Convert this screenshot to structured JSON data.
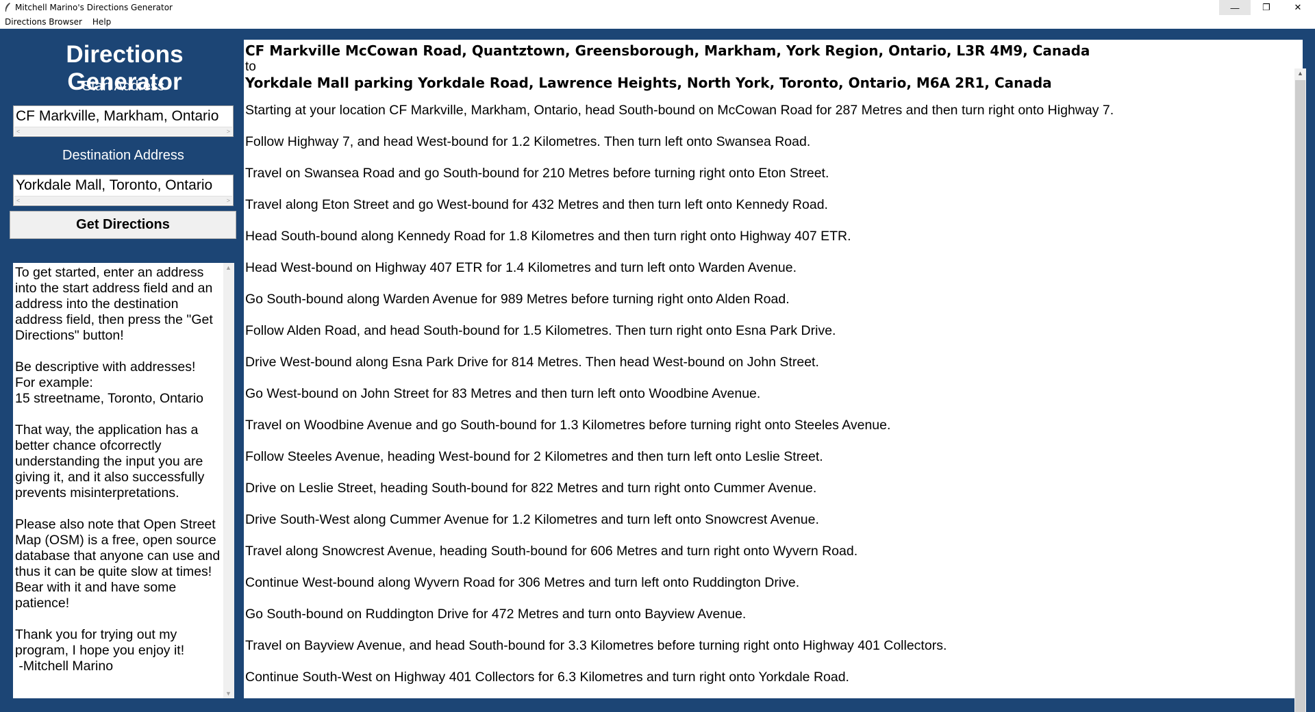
{
  "window": {
    "title": "Mitchell Marino's Directions Generator",
    "minimize_glyph": "—",
    "maximize_glyph": "❐",
    "close_glyph": "✕"
  },
  "menu": {
    "items": [
      "Directions Browser",
      "Help"
    ]
  },
  "sidebar": {
    "heading": "Directions Generator",
    "start_label": "Start Address",
    "start_value": "CF Markville, Markham, Ontario",
    "destination_label": "Destination Address",
    "destination_value": "Yorkdale Mall, Toronto, Ontario",
    "button_label": "Get Directions",
    "info_text": "To get started, enter an address into the start address field and an address into the destination address field, then press the \"Get Directions\" button!\n\nBe descriptive with addresses!\nFor example:\n15 streetname, Toronto, Ontario\n\nThat way, the application has a better chance ofcorrectly understanding the input you are giving it, and it also successfully prevents misinterpretations.\n\nPlease also note that Open Street Map (OSM) is a free, open source database that anyone can use and thus it can be quite slow at times! Bear with it and have some patience!\n\nThank you for trying out my program, I hope you enjoy it!\n -Mitchell Marino"
  },
  "directions": {
    "from": "CF Markville McCowan Road, Quantztown, Greensborough, Markham, York Region, Ontario, L3R 4M9, Canada",
    "to_word": "to",
    "to": "Yorkdale Mall parking Yorkdale Road, Lawrence Heights, North York, Toronto, Ontario, M6A 2R1, Canada",
    "steps": [
      "Starting at your location CF Markville, Markham, Ontario, head South-bound on McCowan Road for 287 Metres and then turn right onto Highway 7.",
      "Follow Highway 7, and head West-bound for 1.2 Kilometres. Then turn left onto Swansea Road.",
      "Travel on Swansea Road and go South-bound for 210 Metres before turning right onto Eton Street.",
      "Travel along Eton Street and go West-bound for 432 Metres and then turn left onto Kennedy Road.",
      "Head South-bound along Kennedy Road for 1.8 Kilometres and then turn right onto Highway 407 ETR.",
      "Head West-bound on Highway 407 ETR for 1.4 Kilometres and turn left onto Warden Avenue.",
      "Go South-bound along Warden Avenue for 989 Metres before turning right onto Alden Road.",
      "Follow Alden Road, and head South-bound for 1.5 Kilometres. Then turn right onto Esna Park Drive.",
      "Drive West-bound along Esna Park Drive for 814 Metres. Then head West-bound on John Street.",
      "Go West-bound on John Street for 83 Metres and then turn left onto Woodbine Avenue.",
      "Travel on Woodbine Avenue and go South-bound for 1.3 Kilometres before turning right onto Steeles Avenue.",
      "Follow Steeles Avenue, heading West-bound for 2 Kilometres and then turn left onto Leslie Street.",
      "Drive on Leslie Street, heading South-bound for 822 Metres and turn right onto Cummer Avenue.",
      "Drive South-West along Cummer Avenue for 1.2 Kilometres and turn left onto Snowcrest Avenue.",
      "Travel along Snowcrest Avenue, heading South-bound for 606 Metres and turn right onto Wyvern Road.",
      "Continue West-bound along Wyvern Road for 306 Metres and turn left onto Ruddington Drive.",
      "Go South-bound on Ruddington Drive for 472 Metres and turn onto Bayview Avenue.",
      "Travel on Bayview Avenue, and head South-bound for 3.3 Kilometres before turning right onto Highway 401 Collectors.",
      "Continue South-West on Highway 401 Collectors for 6.3 Kilometres and turn right onto Yorkdale Road."
    ]
  },
  "colors": {
    "panel_blue": "#1c4575",
    "button_gray": "#f0f0f0"
  }
}
